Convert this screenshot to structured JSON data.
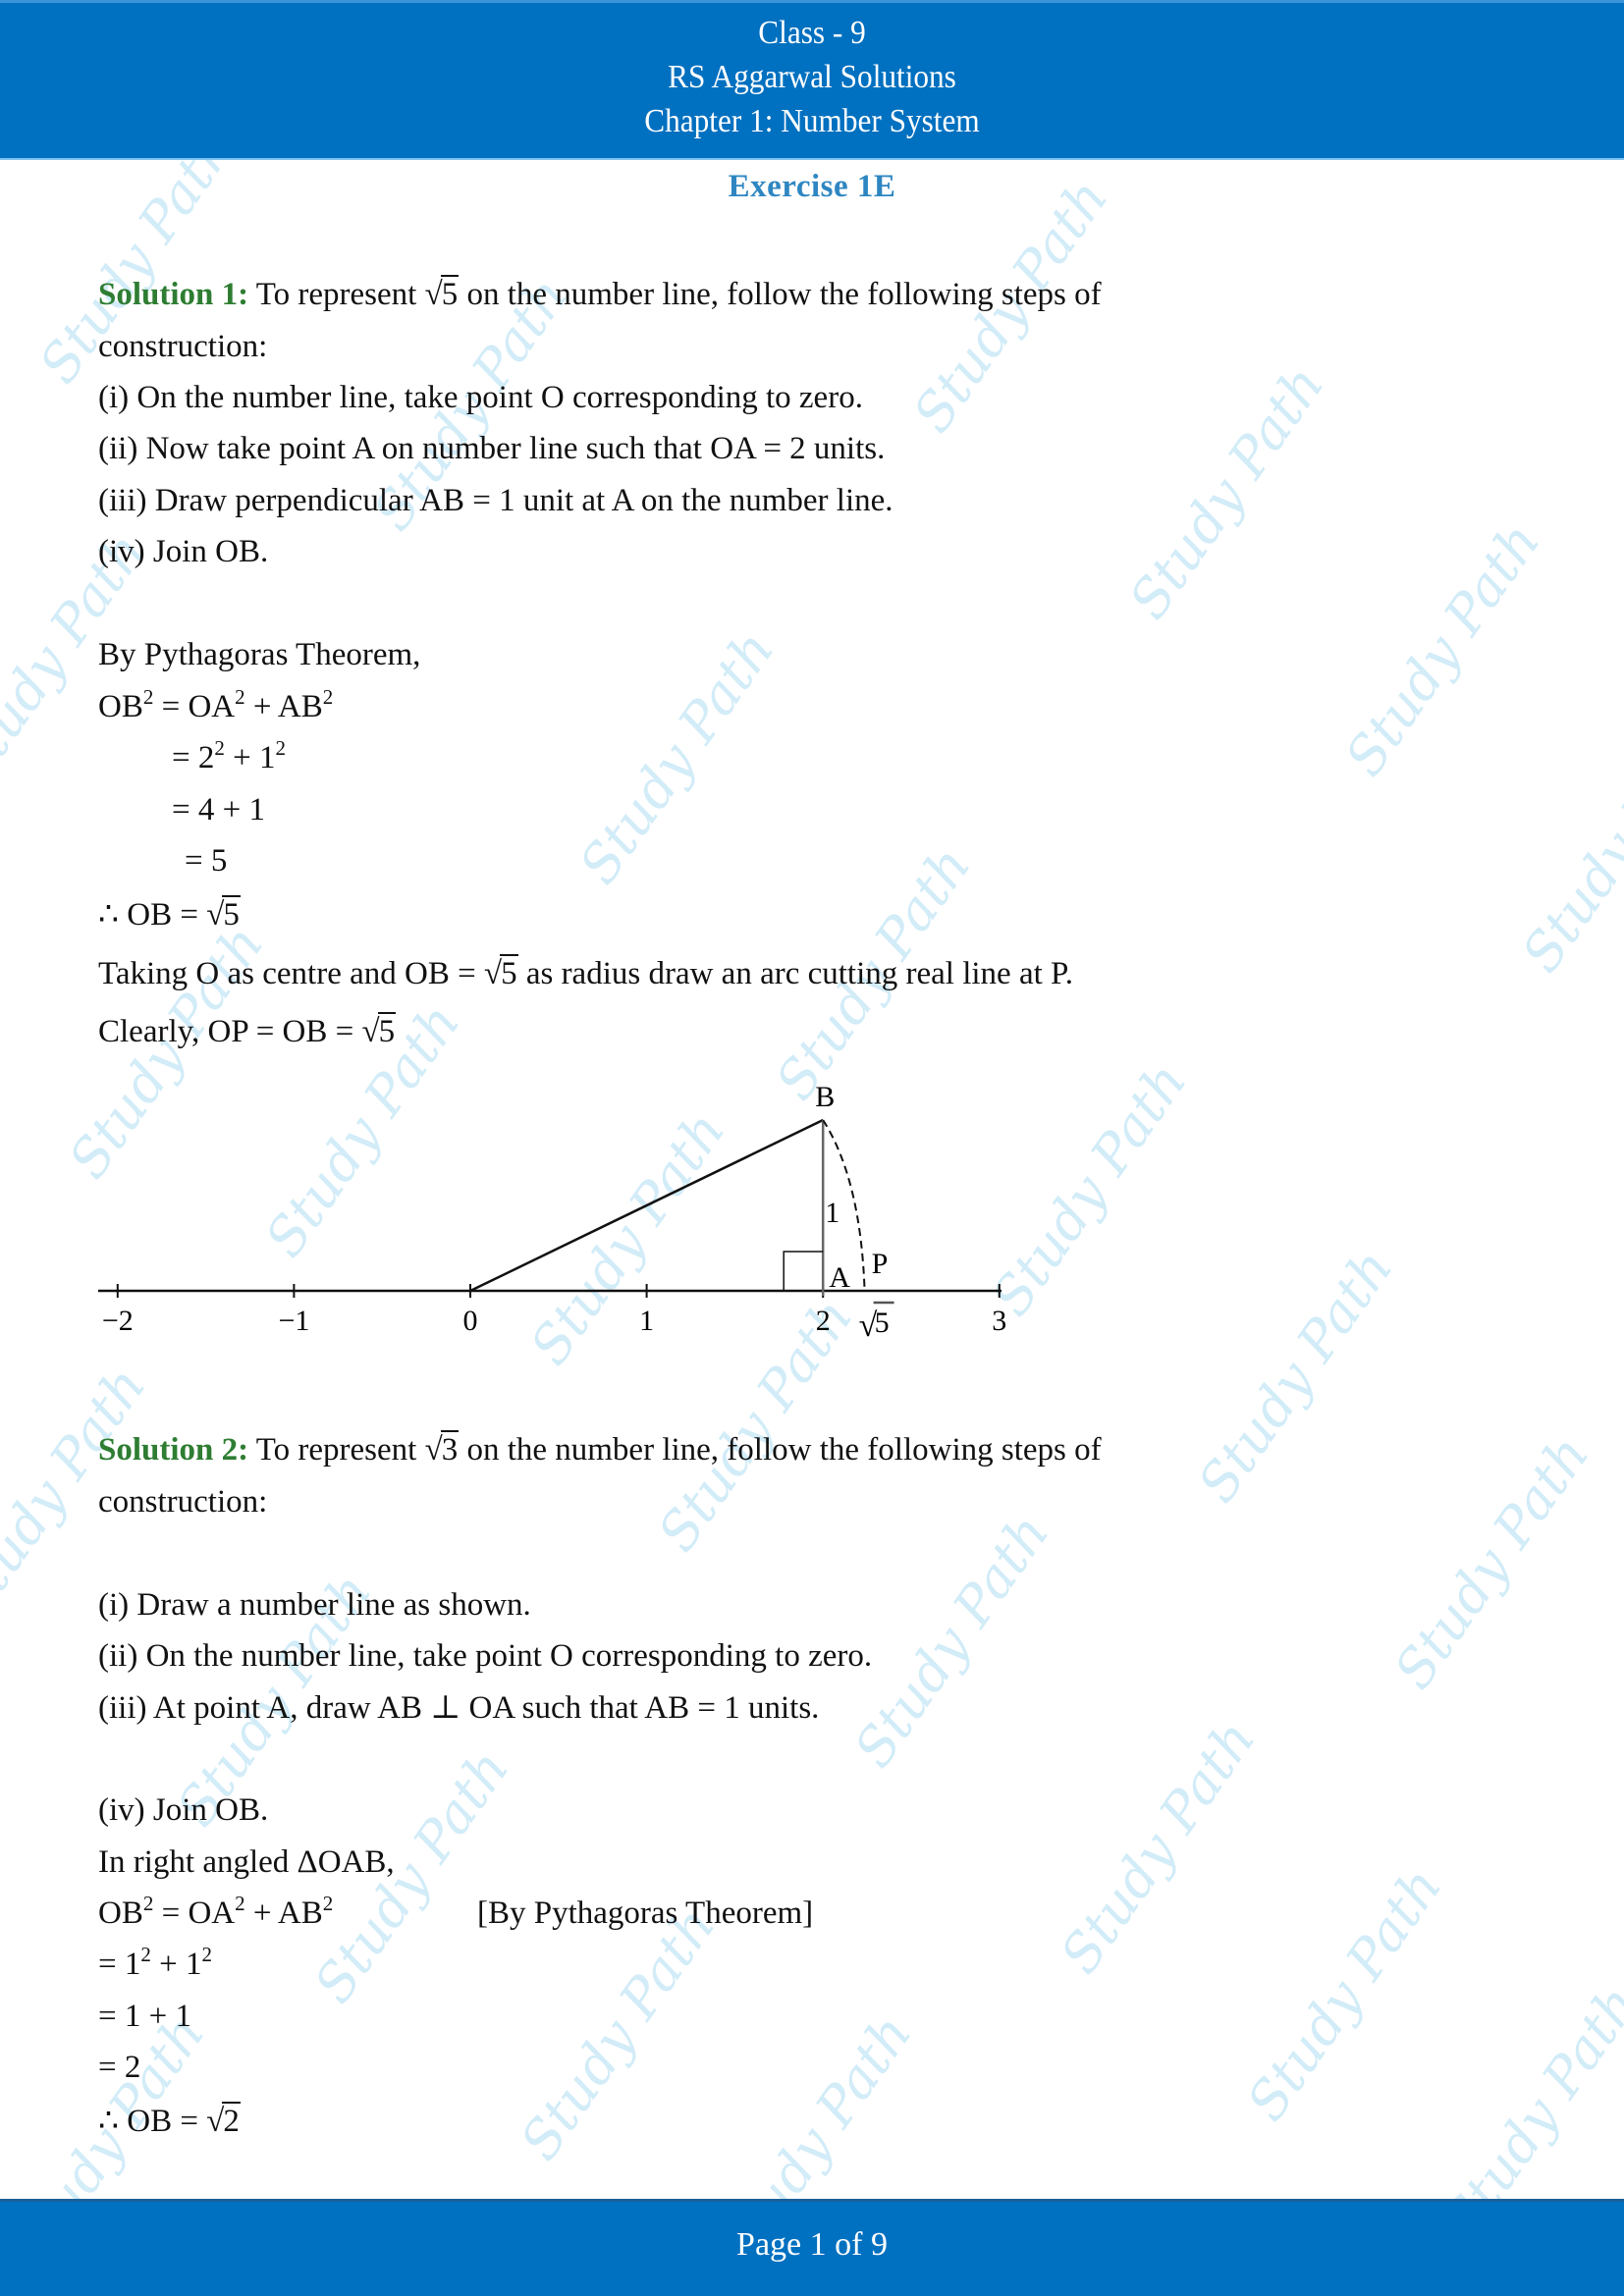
{
  "header": {
    "line1": "Class - 9",
    "line2": "RS Aggarwal Solutions",
    "line3": "Chapter 1: Number System",
    "background_color": "#0070c0"
  },
  "exercise_title": "Exercise 1E",
  "solution1": {
    "label": "Solution 1:",
    "intro_before": "To represent ",
    "intro_radicand": "5",
    "intro_after": " on the number line, follow the following steps of",
    "intro_cont": "construction:",
    "steps": [
      "(i) On the number line, take point O corresponding to zero.",
      "(ii) Now take point A on number line such that OA = 2 units.",
      "(iii) Draw perpendicular AB = 1 unit at A on the number line.",
      "(iv) Join OB."
    ],
    "theorem_line": "By Pythagoras Theorem,",
    "eq1_lhs": "OB",
    "eq1_rhs_a": " = OA",
    "eq1_rhs_b": " + AB",
    "eq2_a": "= 2",
    "eq2_b": " + 1",
    "eq3": "= 4 + 1",
    "eq4": "= 5",
    "therefore_text": "∴ OB = ",
    "therefore_radicand": "5",
    "arc_before": "Taking O as centre and OB = ",
    "arc_radicand": "5",
    "arc_after": " as radius draw an arc cutting real line at P.",
    "clearly_text": "Clearly, OP = OB = ",
    "clearly_radicand": "5"
  },
  "diagram": {
    "tick_labels": [
      "−2",
      "−1",
      "0",
      "1",
      "2",
      "3"
    ],
    "tick_values": [
      -2,
      -1,
      0,
      1,
      2,
      3
    ],
    "point_labels": {
      "B": "B",
      "A": "A",
      "P": "P"
    },
    "side_label": "1",
    "sqrt_label_radicand": "5",
    "OA": 2,
    "AB": 1,
    "OP": 2.236
  },
  "solution2": {
    "label": "Solution 2:",
    "intro_before": "To represent ",
    "intro_radicand": "3",
    "intro_after": " on the number line, follow the following steps of",
    "intro_cont": "construction:",
    "steps": [
      "(i) Draw a number line as shown.",
      "(ii) On the number line, take point O corresponding to zero.",
      "(iii) At point A, draw AB ⊥ OA such that AB = 1 units."
    ],
    "step4": "(iv) Join OB.",
    "triangle_line": "In right angled ΔOAB,",
    "eq1_lhs": "OB",
    "eq1_rhs_a": " = OA",
    "eq1_rhs_b": " + AB",
    "eq1_note": "[By Pythagoras Theorem]",
    "eq2_a": "= 1",
    "eq2_b": " + 1",
    "eq3": "= 1 + 1",
    "eq4": "= 2",
    "therefore_text": "∴ OB = ",
    "therefore_radicand": "2"
  },
  "superscript": "2",
  "radical_sign": "√",
  "footer": {
    "page_label": "Page 1 of 9"
  },
  "watermark_text": "Study Path",
  "colors": {
    "solution_label": "#2e7d32",
    "exercise_title": "#2e86c1",
    "watermark": "#cbe9f7"
  }
}
